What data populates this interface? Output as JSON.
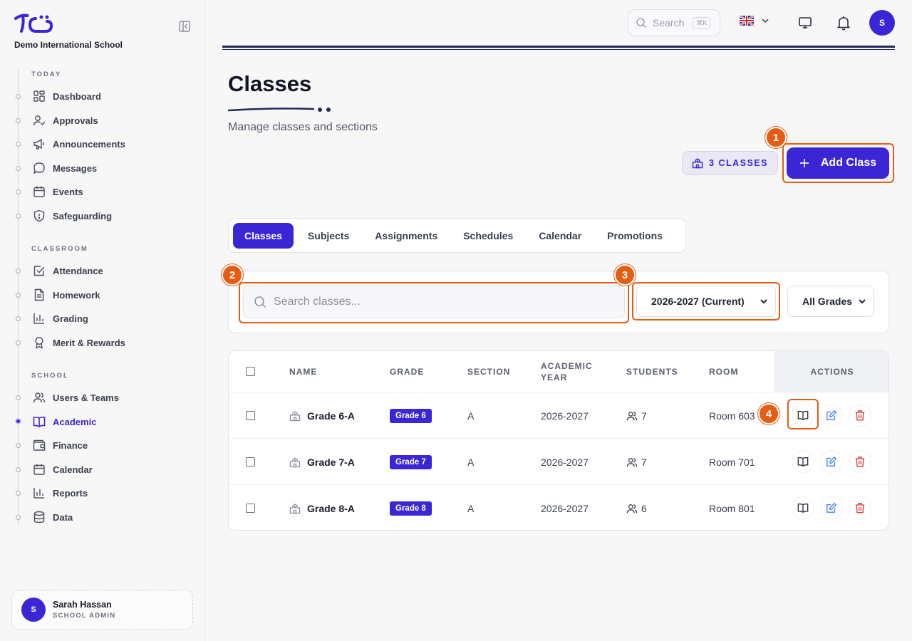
{
  "sidebar": {
    "school_name": "Demo International School",
    "sections": [
      {
        "title": "TODAY",
        "items": [
          {
            "label": "Dashboard",
            "icon": "dashboard-icon"
          },
          {
            "label": "Approvals",
            "icon": "user-check-icon"
          },
          {
            "label": "Announcements",
            "icon": "megaphone-icon"
          },
          {
            "label": "Messages",
            "icon": "chat-bubble-icon"
          },
          {
            "label": "Events",
            "icon": "calendar-icon"
          },
          {
            "label": "Safeguarding",
            "icon": "shield-icon"
          }
        ]
      },
      {
        "title": "CLASSROOM",
        "items": [
          {
            "label": "Attendance",
            "icon": "checkbox-icon"
          },
          {
            "label": "Homework",
            "icon": "document-icon"
          },
          {
            "label": "Grading",
            "icon": "bar-chart-icon"
          },
          {
            "label": "Merit & Rewards",
            "icon": "award-icon"
          }
        ]
      },
      {
        "title": "SCHOOL",
        "items": [
          {
            "label": "Users & Teams",
            "icon": "users-icon"
          },
          {
            "label": "Academic",
            "icon": "book-open-icon",
            "active": true
          },
          {
            "label": "Finance",
            "icon": "wallet-icon"
          },
          {
            "label": "Calendar",
            "icon": "calendar-icon"
          },
          {
            "label": "Reports",
            "icon": "bar-chart-icon"
          },
          {
            "label": "Data",
            "icon": "database-icon"
          }
        ]
      }
    ],
    "user": {
      "initial": "S",
      "name": "Sarah Hassan",
      "role": "SCHOOL ADMIN"
    }
  },
  "topbar": {
    "search_placeholder": "Search",
    "shortcut": "⌘K",
    "language_flag": "uk-flag",
    "avatar_initial": "S"
  },
  "page": {
    "title": "Classes",
    "subtitle": "Manage classes and sections",
    "count_label": "3 CLASSES",
    "add_button": "Add Class"
  },
  "tabs": [
    {
      "label": "Classes",
      "active": true
    },
    {
      "label": "Subjects"
    },
    {
      "label": "Assignments"
    },
    {
      "label": "Schedules"
    },
    {
      "label": "Calendar"
    },
    {
      "label": "Promotions"
    }
  ],
  "filters": {
    "search_placeholder": "Search classes...",
    "year_selected": "2026-2027 (Current)",
    "grade_selected": "All Grades"
  },
  "table": {
    "headers": {
      "name": "NAME",
      "grade": "GRADE",
      "section": "SECTION",
      "year_line1": "ACADEMIC",
      "year_line2": "YEAR",
      "students": "STUDENTS",
      "room": "ROOM",
      "actions": "ACTIONS"
    },
    "rows": [
      {
        "name": "Grade 6-A",
        "grade": "Grade 6",
        "section": "A",
        "year": "2026-2027",
        "students": "7",
        "room": "Room 603"
      },
      {
        "name": "Grade 7-A",
        "grade": "Grade 7",
        "section": "A",
        "year": "2026-2027",
        "students": "7",
        "room": "Room 701"
      },
      {
        "name": "Grade 8-A",
        "grade": "Grade 8",
        "section": "A",
        "year": "2026-2027",
        "students": "6",
        "room": "Room 801"
      }
    ]
  },
  "annotations": [
    "1",
    "2",
    "3",
    "4"
  ],
  "colors": {
    "accent": "#3b26d6",
    "highlight": "#e45d13",
    "edit": "#3b82f6",
    "delete": "#e03a3a"
  }
}
